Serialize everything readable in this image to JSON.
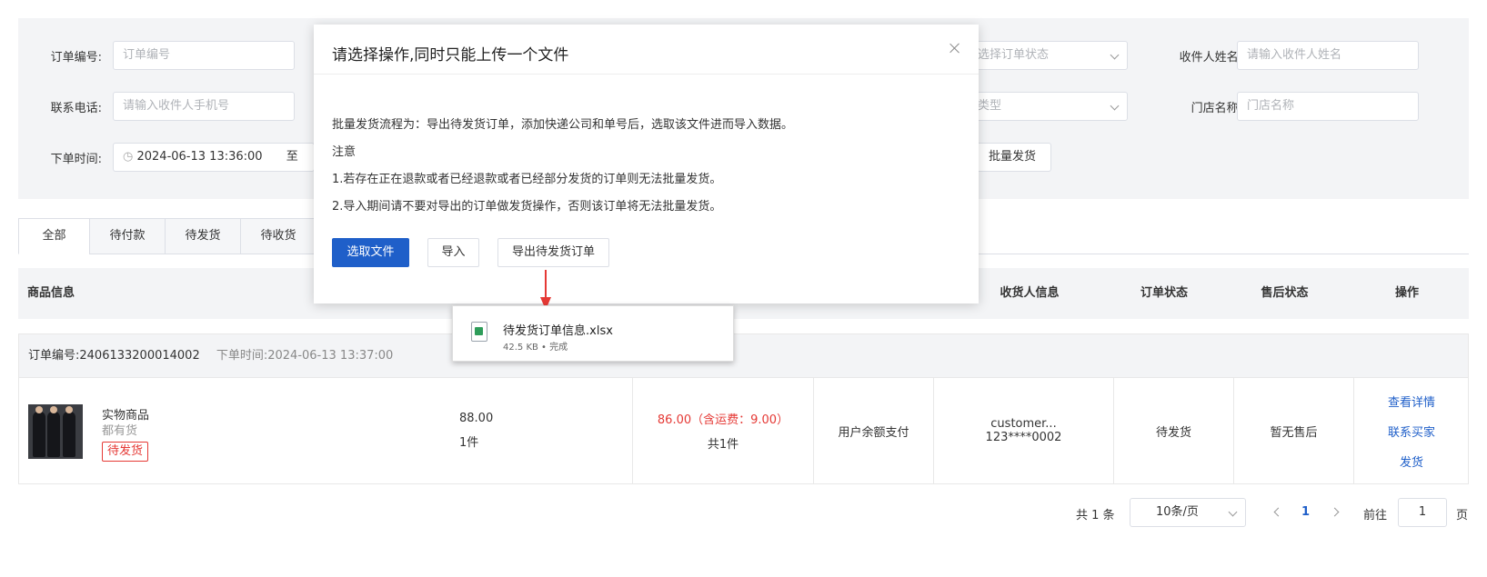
{
  "filters": {
    "order_no_label": "订单编号:",
    "order_no_placeholder": "订单编号",
    "phone_label": "联系电话:",
    "phone_placeholder": "请输入收件人手机号",
    "time_label": "下单时间:",
    "time_value": "2024-06-13 13:36:00",
    "time_sep": "至",
    "status_placeholder_partial": "选择订单状态",
    "type_placeholder_partial": "类型",
    "receiver_label": "收件人姓名:",
    "receiver_placeholder": "请输入收件人姓名",
    "store_label": "门店名称:",
    "store_placeholder": "门店名称",
    "batch_btn": "批量发货"
  },
  "tabs": [
    "全部",
    "待付款",
    "待发货",
    "待收货"
  ],
  "table": {
    "headers": {
      "product": "商品信息",
      "receiver": "收货人信息",
      "order_status": "订单状态",
      "after_sale": "售后状态",
      "actions": "操作"
    },
    "order": {
      "order_no": "订单编号:2406133200014002",
      "order_time": "下单时间:2024-06-13 13:37:00",
      "product_name": "实物商品",
      "product_stock": "都有货",
      "product_tag": "待发货",
      "price": "88.00",
      "qty": "1件",
      "total": "86.00（含运费：9.00）",
      "total_count": "共1件",
      "pay_method": "用户余额支付",
      "customer": "customer...",
      "customer_phone": "123****0002",
      "order_status": "待发货",
      "after_sale": "暂无售后",
      "actions": [
        "查看详情",
        "联系买家",
        "发货"
      ]
    }
  },
  "pagination": {
    "total": "共 1 条",
    "page_size": "10条/页",
    "current": "1",
    "goto_label": "前往",
    "goto_value": "1",
    "page_suffix": "页"
  },
  "modal": {
    "title": "请选择操作,同时只能上传一个文件",
    "process": "批量发货流程为：导出待发货订单，添加快递公司和单号后，选取该文件进而导入数据。",
    "note_title": "注意",
    "note_1": "1.若存在正在退款或者已经退款或者已经部分发货的订单则无法批量发货。",
    "note_2": "2.导入期间请不要对导出的订单做发货操作，否则该订单将无法批量发货。",
    "btn_select": "选取文件",
    "btn_import": "导入",
    "btn_export": "导出待发货订单"
  },
  "download": {
    "file_name": "待发货订单信息.xlsx",
    "file_meta": "42.5 KB • 完成"
  },
  "colors": {
    "primary": "#1f5fc9",
    "danger": "#e53935"
  }
}
